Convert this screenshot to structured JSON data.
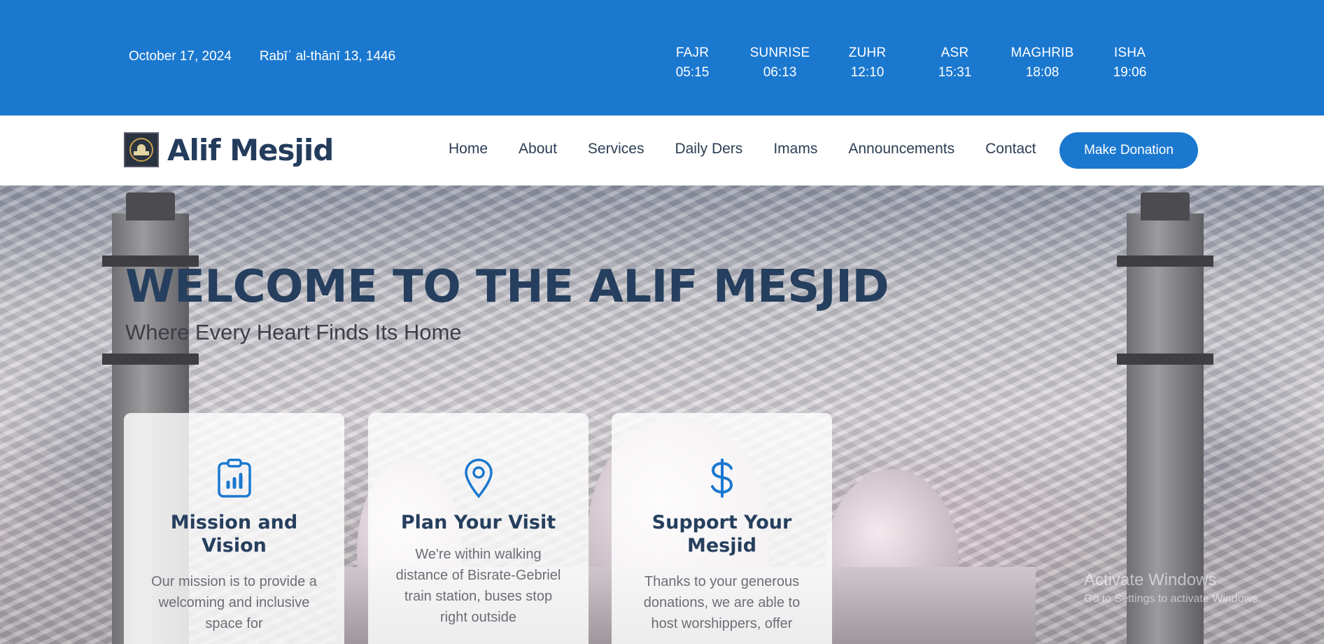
{
  "topbar": {
    "gregorian_date": "October 17, 2024",
    "hijri_date": "Rabīʿ al-thānī 13, 1446",
    "prayers": [
      {
        "name": "FAJR",
        "time": "05:15"
      },
      {
        "name": "SUNRISE",
        "time": "06:13"
      },
      {
        "name": "ZUHR",
        "time": "12:10"
      },
      {
        "name": "ASR",
        "time": "15:31"
      },
      {
        "name": "MAGHRIB",
        "time": "18:08"
      },
      {
        "name": "ISHA",
        "time": "19:06"
      }
    ]
  },
  "nav": {
    "brand": "Alif Mesjid",
    "items": [
      "Home",
      "About",
      "Services",
      "Daily Ders",
      "Imams",
      "Announcements",
      "Contact"
    ],
    "donate_label": "Make Donation"
  },
  "hero": {
    "title": "WELCOME TO THE ALIF MESJID",
    "subtitle": "Where Every Heart Finds Its Home",
    "cards": [
      {
        "icon": "clipboard-chart-icon",
        "title": "Mission and Vision",
        "text": "Our mission is to provide a welcoming and inclusive space for"
      },
      {
        "icon": "map-pin-icon",
        "title": "Plan Your Visit",
        "text": "We're within walking distance of Bisrate-Gebriel train station, buses stop right outside"
      },
      {
        "icon": "dollar-icon",
        "title": "Support Your Mesjid",
        "text": "Thanks to your generous donations, we are able to host worshippers, offer"
      }
    ]
  },
  "watermark": {
    "line1": "Activate Windows",
    "line2": "Go to Settings to activate Windows."
  },
  "colors": {
    "primary": "#1b78cf",
    "heading": "#263f5e",
    "nav_text": "#2b3d53"
  }
}
